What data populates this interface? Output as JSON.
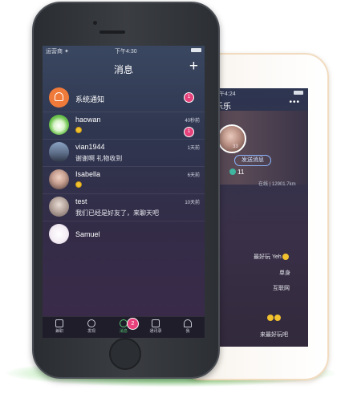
{
  "colors": {
    "accent": "#e7417b",
    "active_tab": "#55c870",
    "glow": "#56d250"
  },
  "front": {
    "status": {
      "carrier": "运营商 ✦",
      "time": "下午4:30"
    },
    "nav": {
      "title": "消息",
      "add_icon": "plus-icon"
    },
    "conversations": [
      {
        "name": "系统通知",
        "message": "",
        "time": "",
        "badge": "1",
        "avatar_icon": "bell-icon"
      },
      {
        "name": "haowan",
        "message": "",
        "time": "40秒前",
        "badge": "1",
        "has_emoji": true
      },
      {
        "name": "vian1944",
        "message": "谢谢啊  礼物收到",
        "time": "1天前",
        "badge": ""
      },
      {
        "name": "Isabella",
        "message": "",
        "time": "6天前",
        "badge": "",
        "has_emoji": true
      },
      {
        "name": "test",
        "message": "我们已经是好友了，来聊天吧",
        "time": "10天前",
        "badge": ""
      },
      {
        "name": "Samuel",
        "message": "",
        "time": "",
        "badge": ""
      }
    ],
    "tabs": [
      {
        "label": "兼职",
        "icon": "gift-icon"
      },
      {
        "label": "发现",
        "icon": "compass-icon"
      },
      {
        "label": "消息",
        "icon": "chat-icon",
        "badge": "2"
      },
      {
        "label": "通讯录",
        "icon": "contacts-icon"
      },
      {
        "label": "我",
        "icon": "person-icon"
      }
    ]
  },
  "back": {
    "status": {
      "time": "下午4:24"
    },
    "title": "乐乐",
    "more_icon": "•••",
    "profile": {
      "level": "33",
      "send_message_label": "发送消息",
      "stat_value": "11",
      "online_text": "在线 | 12901.7km"
    },
    "messages": [
      {
        "text": "最好玩 Yeh"
      },
      {
        "text": "单身"
      },
      {
        "text": "互联网"
      },
      {
        "text": "来最好玩吧"
      }
    ]
  }
}
